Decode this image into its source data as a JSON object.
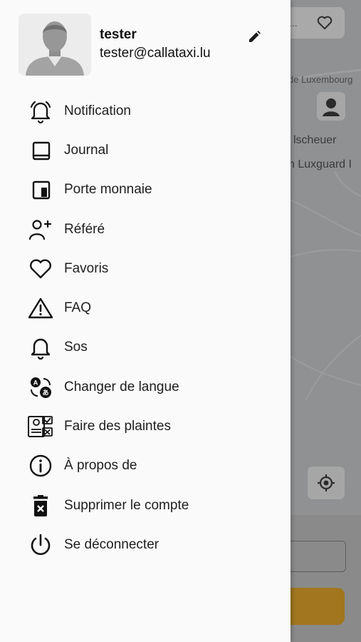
{
  "profile": {
    "name": "tester",
    "email": "tester@callataxi.lu"
  },
  "menu": [
    {
      "label": "Notification",
      "icon": "bell-ringing-icon"
    },
    {
      "label": "Journal",
      "icon": "book-icon"
    },
    {
      "label": "Porte monnaie",
      "icon": "wallet-icon"
    },
    {
      "label": "Référé",
      "icon": "person-add-icon"
    },
    {
      "label": "Favoris",
      "icon": "heart-icon"
    },
    {
      "label": "FAQ",
      "icon": "warning-icon"
    },
    {
      "label": "Sos",
      "icon": "bell-icon"
    },
    {
      "label": "Changer de langue",
      "icon": "translate-icon"
    },
    {
      "label": "Faire des plaintes",
      "icon": "complaint-icon"
    },
    {
      "label": "À propos de",
      "icon": "info-icon"
    },
    {
      "label": "Supprimer le compte",
      "icon": "delete-icon"
    },
    {
      "label": "Se déconnecter",
      "icon": "power-icon"
    }
  ],
  "map": {
    "labels": [
      "de Luxembourg",
      "lscheuer",
      "n Luxguard I"
    ],
    "search_text": "..."
  },
  "colors": {
    "drawer_bg": "#fafafa",
    "overlay": "#8f9192",
    "cta": "#a1761f"
  }
}
